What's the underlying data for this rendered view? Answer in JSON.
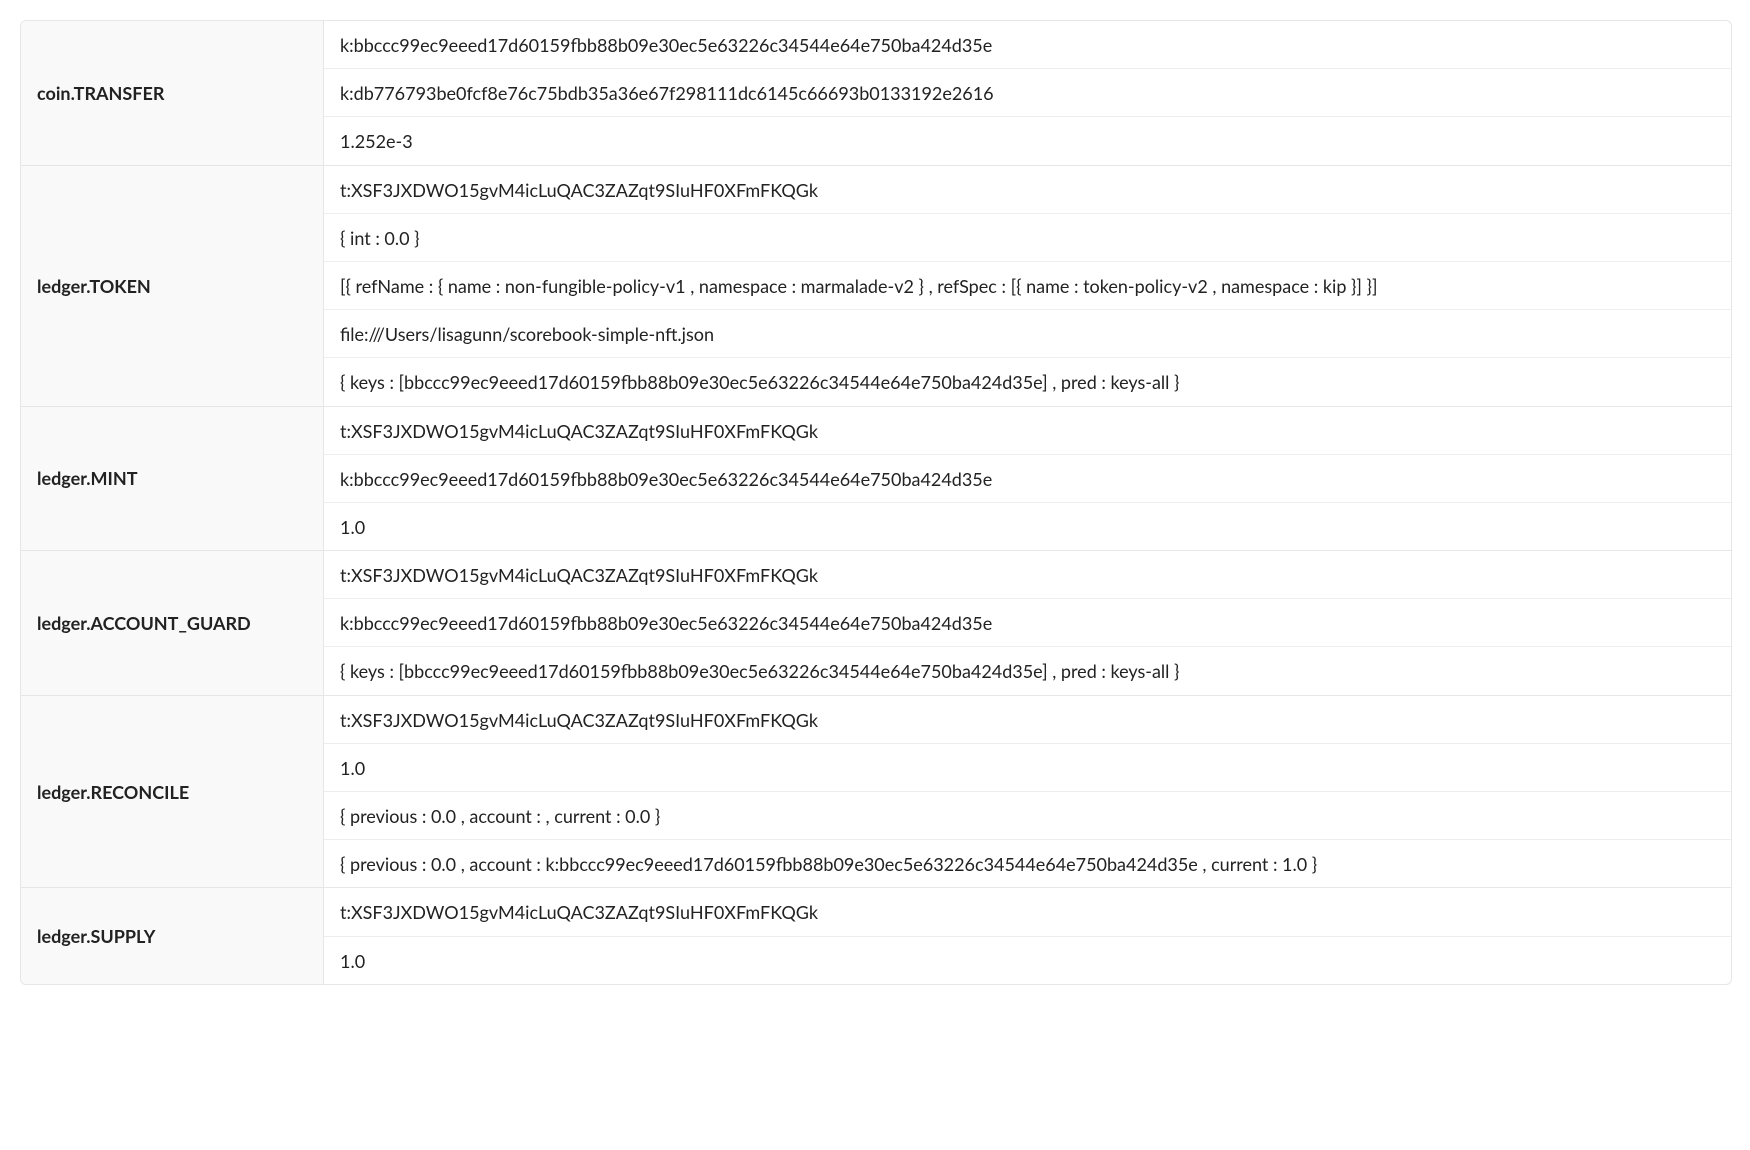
{
  "rows": [
    {
      "label": "coin.TRANSFER",
      "values": [
        "k:bbccc99ec9eeed17d60159fbb88b09e30ec5e63226c34544e64e750ba424d35e",
        "k:db776793be0fcf8e76c75bdb35a36e67f298111dc6145c66693b0133192e2616",
        "1.252e-3"
      ]
    },
    {
      "label": "ledger.TOKEN",
      "values": [
        "t:XSF3JXDWO15gvM4icLuQAC3ZAZqt9SIuHF0XFmFKQGk",
        "{ int : 0.0 }",
        "[{ refName : { name : non-fungible-policy-v1 , namespace : marmalade-v2 } , refSpec : [{ name : token-policy-v2 , namespace : kip }] }]",
        "file:///Users/lisagunn/scorebook-simple-nft.json",
        "{ keys : [bbccc99ec9eeed17d60159fbb88b09e30ec5e63226c34544e64e750ba424d35e] , pred : keys-all }"
      ]
    },
    {
      "label": "ledger.MINT",
      "values": [
        "t:XSF3JXDWO15gvM4icLuQAC3ZAZqt9SIuHF0XFmFKQGk",
        "k:bbccc99ec9eeed17d60159fbb88b09e30ec5e63226c34544e64e750ba424d35e",
        "1.0"
      ]
    },
    {
      "label": "ledger.ACCOUNT_GUARD",
      "values": [
        "t:XSF3JXDWO15gvM4icLuQAC3ZAZqt9SIuHF0XFmFKQGk",
        "k:bbccc99ec9eeed17d60159fbb88b09e30ec5e63226c34544e64e750ba424d35e",
        "{ keys : [bbccc99ec9eeed17d60159fbb88b09e30ec5e63226c34544e64e750ba424d35e] , pred : keys-all }"
      ]
    },
    {
      "label": "ledger.RECONCILE",
      "values": [
        "t:XSF3JXDWO15gvM4icLuQAC3ZAZqt9SIuHF0XFmFKQGk",
        "1.0",
        "{ previous : 0.0 , account : , current : 0.0 }",
        "{ previous : 0.0 , account : k:bbccc99ec9eeed17d60159fbb88b09e30ec5e63226c34544e64e750ba424d35e , current : 1.0 }"
      ]
    },
    {
      "label": "ledger.SUPPLY",
      "values": [
        "t:XSF3JXDWO15gvM4icLuQAC3ZAZqt9SIuHF0XFmFKQGk",
        "1.0"
      ]
    }
  ]
}
